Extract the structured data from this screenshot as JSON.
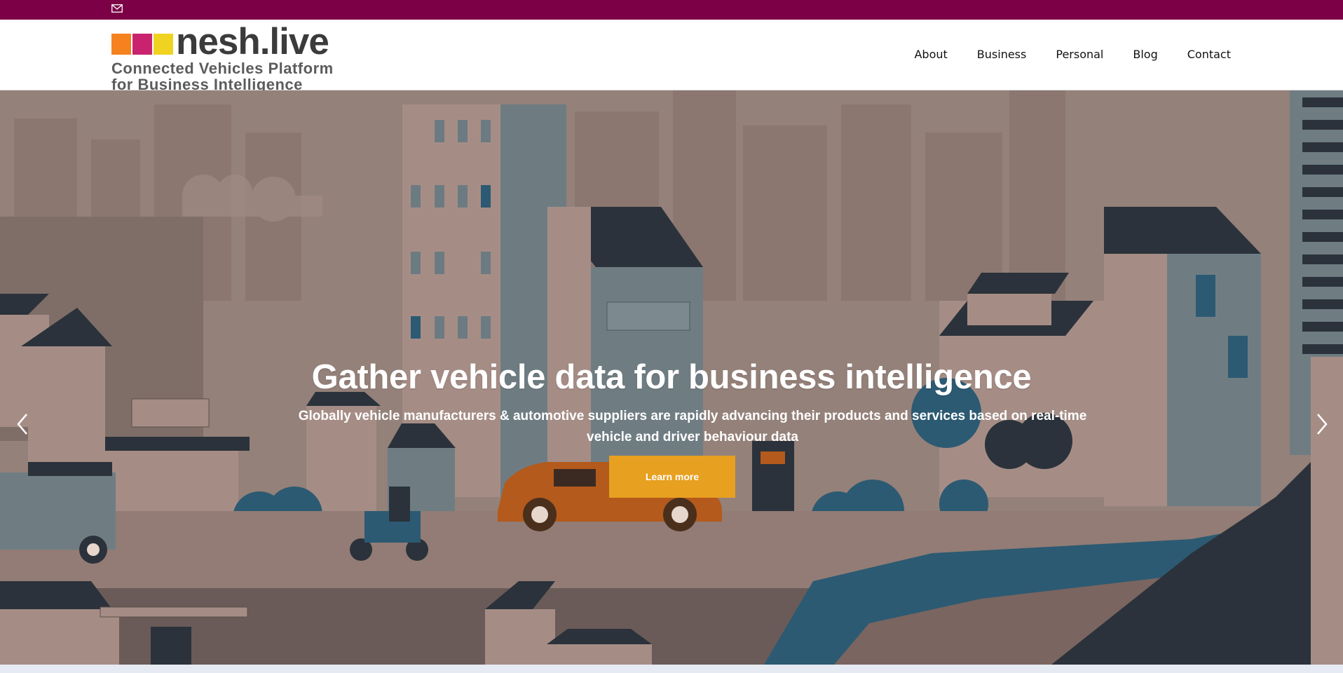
{
  "topbar": {
    "icon": "mail-icon",
    "color": "#7b0045"
  },
  "logo": {
    "name": "nesh.live",
    "tagline_line1": "Connected Vehicles Platform",
    "tagline_line2": "for Business Intelligence",
    "colors": [
      "#f5821f",
      "#c9236f",
      "#f0d321"
    ]
  },
  "nav": {
    "items": [
      {
        "label": "About"
      },
      {
        "label": "Business"
      },
      {
        "label": "Personal"
      },
      {
        "label": "Blog"
      },
      {
        "label": "Contact"
      }
    ]
  },
  "hero": {
    "title": "Gather vehicle data for business intelligence",
    "subtitle": "Globally vehicle manufacturers & automotive suppliers are rapidly advancing their products and services based on real-time vehicle and driver behaviour data",
    "cta_label": "Learn more",
    "cta_color": "#e8a020",
    "prev_icon": "chevron-left-icon",
    "next_icon": "chevron-right-icon"
  }
}
